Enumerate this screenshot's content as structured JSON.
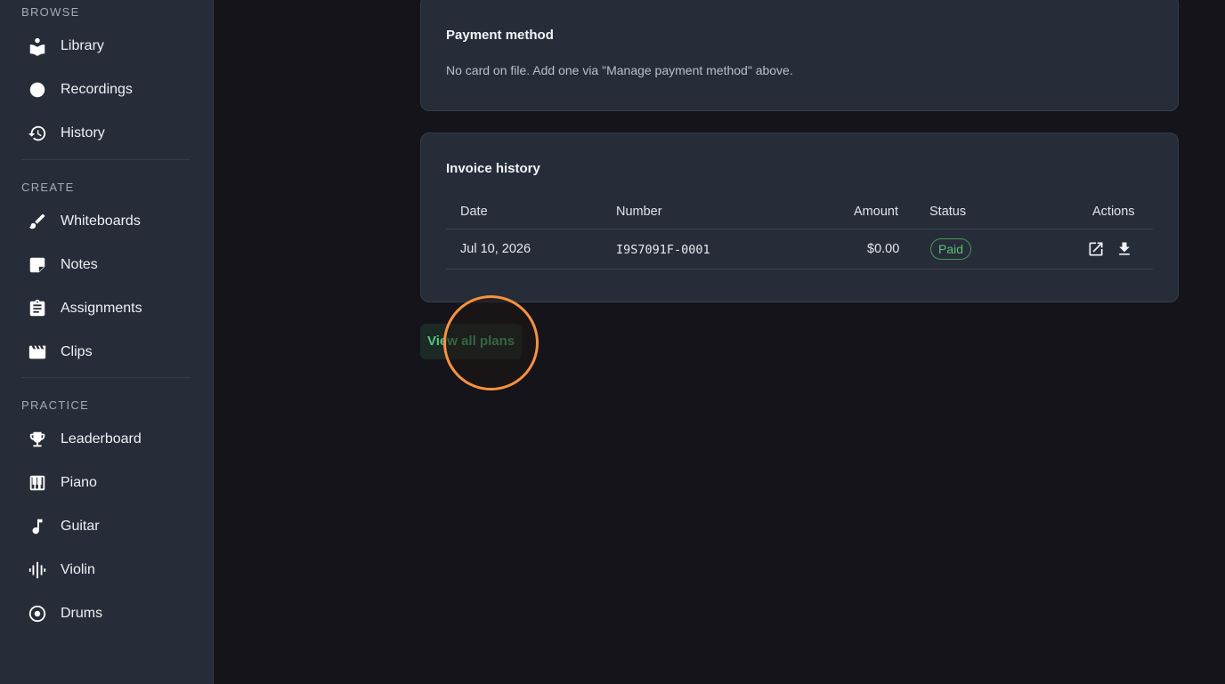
{
  "sidebar": {
    "sections": [
      {
        "label": "BROWSE"
      },
      {
        "label": "CREATE"
      },
      {
        "label": "PRACTICE"
      }
    ],
    "items": [
      {
        "label": "Library",
        "icon": "library-icon"
      },
      {
        "label": "Recordings",
        "icon": "record-icon"
      },
      {
        "label": "History",
        "icon": "history-icon"
      },
      {
        "label": "Whiteboards",
        "icon": "brush-icon"
      },
      {
        "label": "Notes",
        "icon": "note-icon"
      },
      {
        "label": "Assignments",
        "icon": "clipboard-icon"
      },
      {
        "label": "Clips",
        "icon": "clapperboard-icon"
      },
      {
        "label": "Leaderboard",
        "icon": "trophy-icon"
      },
      {
        "label": "Piano",
        "icon": "piano-icon"
      },
      {
        "label": "Guitar",
        "icon": "music-note-icon"
      },
      {
        "label": "Violin",
        "icon": "waveform-icon"
      },
      {
        "label": "Drums",
        "icon": "drum-icon"
      }
    ]
  },
  "payment": {
    "title": "Payment method",
    "text": "No card on file. Add one via \"Manage payment method\" above."
  },
  "invoices": {
    "title": "Invoice history",
    "columns": [
      "Date",
      "Number",
      "Amount",
      "Status",
      "Actions"
    ],
    "rows": [
      {
        "date": "Jul 10, 2026",
        "number": "I9S7091F-0001",
        "amount": "$0.00",
        "status": "Paid"
      }
    ],
    "actions": [
      "open-external-icon",
      "download-icon"
    ]
  },
  "plans_button": {
    "label": "View all plans"
  },
  "colors": {
    "accent": "#57c184",
    "focus_ring": "#f7923f",
    "status_paid": "#5cc078"
  }
}
